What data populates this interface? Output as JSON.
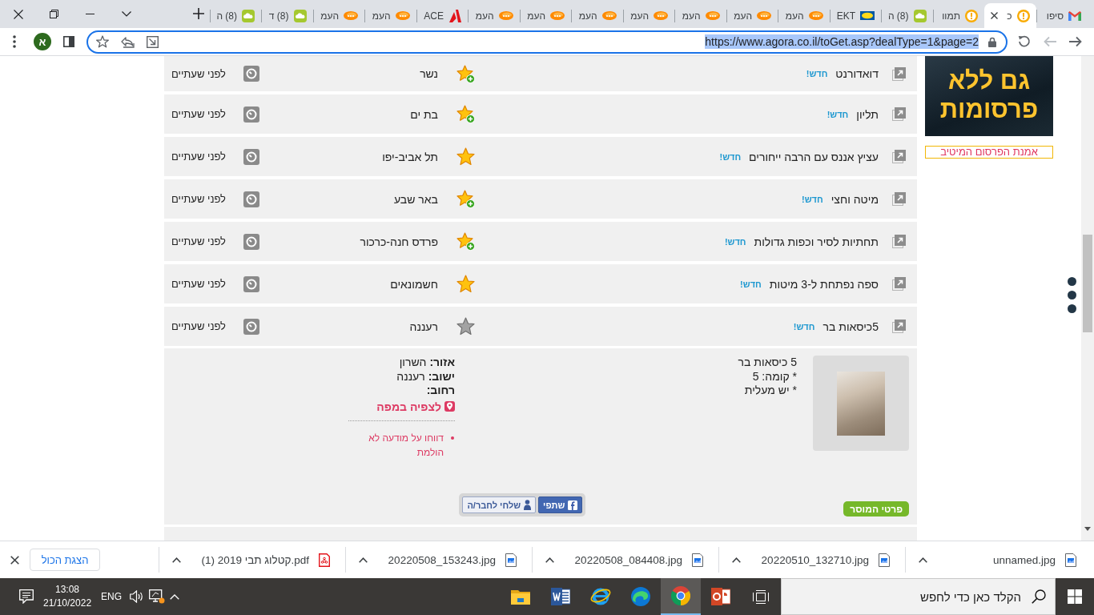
{
  "browser": {
    "tabs": [
      {
        "title": "סיפו",
        "kind": "mail",
        "selected": false
      },
      {
        "title": "כ",
        "kind": "alert",
        "selected": true
      },
      {
        "title": "תמוו",
        "kind": "alert",
        "selected": false
      },
      {
        "title": "(8) ה",
        "kind": "cloud",
        "selected": false
      },
      {
        "title": "EKT",
        "kind": "badge",
        "selected": false
      },
      {
        "title": "העמ",
        "kind": "oval",
        "selected": false
      },
      {
        "title": "העמ",
        "kind": "oval",
        "selected": false
      },
      {
        "title": "העמ",
        "kind": "oval",
        "selected": false
      },
      {
        "title": "העמ",
        "kind": "oval",
        "selected": false
      },
      {
        "title": "העמ",
        "kind": "oval",
        "selected": false
      },
      {
        "title": "העמ",
        "kind": "oval",
        "selected": false
      },
      {
        "title": "העמ",
        "kind": "oval",
        "selected": false
      },
      {
        "title": "ACE",
        "kind": "triangle",
        "selected": false
      },
      {
        "title": "העמ",
        "kind": "oval",
        "selected": false
      },
      {
        "title": "העמ",
        "kind": "oval",
        "selected": false
      },
      {
        "title": "(8) ד",
        "kind": "cloud",
        "selected": false
      },
      {
        "title": "(8) ה",
        "kind": "cloud",
        "selected": false
      }
    ],
    "back": {
      "disabled": false
    },
    "forward": {
      "disabled": true
    },
    "address": {
      "url": "https://www.agora.co.il/toGet.asp?dealType=1&page=2",
      "selected": true
    },
    "profile": {
      "initial": "א"
    }
  },
  "listings": [
    {
      "title": "דואדורנט",
      "badge": "חדש!",
      "city": "נשר",
      "kind": "plus",
      "time": "לפני שעתיים"
    },
    {
      "title": "תליון",
      "badge": "חדש!",
      "city": "בת ים",
      "kind": "plus",
      "time": "לפני שעתיים"
    },
    {
      "title": "עציץ אננס עם הרבה ייחורים",
      "badge": "חדש!",
      "city": "תל אביב-יפו",
      "kind": "filled",
      "time": "לפני שעתיים"
    },
    {
      "title": "מיטה וחצי",
      "badge": "חדש!",
      "city": "באר שבע",
      "kind": "plus",
      "time": "לפני שעתיים"
    },
    {
      "title": "תחתיות לסיר וכפות גדולות",
      "badge": "חדש!",
      "city": "פרדס חנה-כרכור",
      "kind": "plus",
      "time": "לפני שעתיים"
    },
    {
      "title": "ספה נפתחת ל-3 מיטות",
      "badge": "חדש!",
      "city": "חשמונאים",
      "kind": "filled",
      "time": "לפני שעתיים"
    },
    {
      "title": "5כיסאות בר",
      "badge": "חדש!",
      "city": "רעננה",
      "kind": "dim",
      "time": "לפני שעתיים"
    }
  ],
  "details": {
    "description": [
      "5 כיסאות בר",
      "* קומה: 5",
      "* יש מעלית"
    ],
    "location": [
      {
        "label": "אזור:",
        "value": "השרון"
      },
      {
        "label": "ישוב:",
        "value": "רעננה"
      },
      {
        "label": "רחוב:"
      }
    ],
    "map_link": "לצפיה במפה",
    "report_link": "דווחו על מודעה לא הולמת",
    "share": [
      {
        "label": "שתפי",
        "kind": "facebook"
      },
      {
        "label": "שלחי לחבר/ה",
        "kind": "friend"
      }
    ],
    "seller_button": "פרטי המוסר"
  },
  "ad": {
    "banner_lines": [
      "גם ללא",
      "פרסומות"
    ],
    "link": "אמנת הפרסום המיטיב"
  },
  "downloads": {
    "items": [
      {
        "name": "unnamed.jpg",
        "kind": "image"
      },
      {
        "name": "20220510_132710.jpg",
        "kind": "image"
      },
      {
        "name": "20220508_084408.jpg",
        "kind": "image"
      },
      {
        "name": "20220508_153243.jpg",
        "kind": "image"
      },
      {
        "name": "קטלוג תבי 2019 (1).pdf",
        "kind": "pdf"
      }
    ],
    "show_all": "הצגת הכול"
  },
  "taskbar": {
    "search": {
      "placeholder": "הקלד כאן כדי לחפש"
    },
    "apps": [
      {
        "kind": "taskview",
        "active": false
      },
      {
        "kind": "slides",
        "active": false
      },
      {
        "kind": "wheel",
        "active": true
      },
      {
        "kind": "swirl",
        "active": false
      },
      {
        "kind": "ebrowser",
        "active": false
      },
      {
        "kind": "docs",
        "active": false
      },
      {
        "kind": "folder",
        "active": false
      }
    ],
    "language": "ENG",
    "time": "13:08",
    "date": "21/10/2022"
  }
}
